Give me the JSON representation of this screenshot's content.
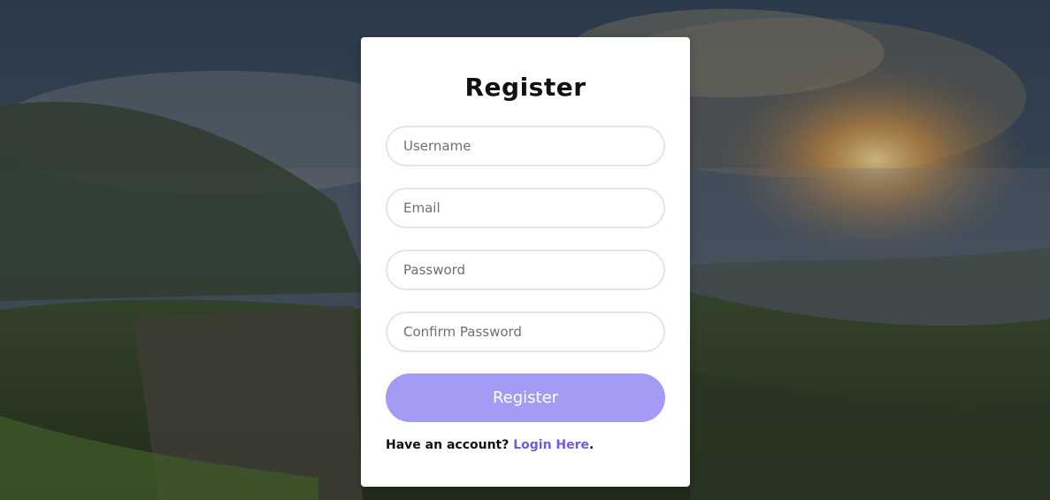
{
  "form": {
    "title": "Register",
    "username_placeholder": "Username",
    "email_placeholder": "Email",
    "password_placeholder": "Password",
    "confirm_password_placeholder": "Confirm Password",
    "submit_label": "Register",
    "footer_prompt": "Have an account? ",
    "login_link_label": "Login Here",
    "footer_period": "."
  },
  "colors": {
    "button": "#a49bf4",
    "link": "#6b5ce7",
    "card": "#ffffff"
  }
}
